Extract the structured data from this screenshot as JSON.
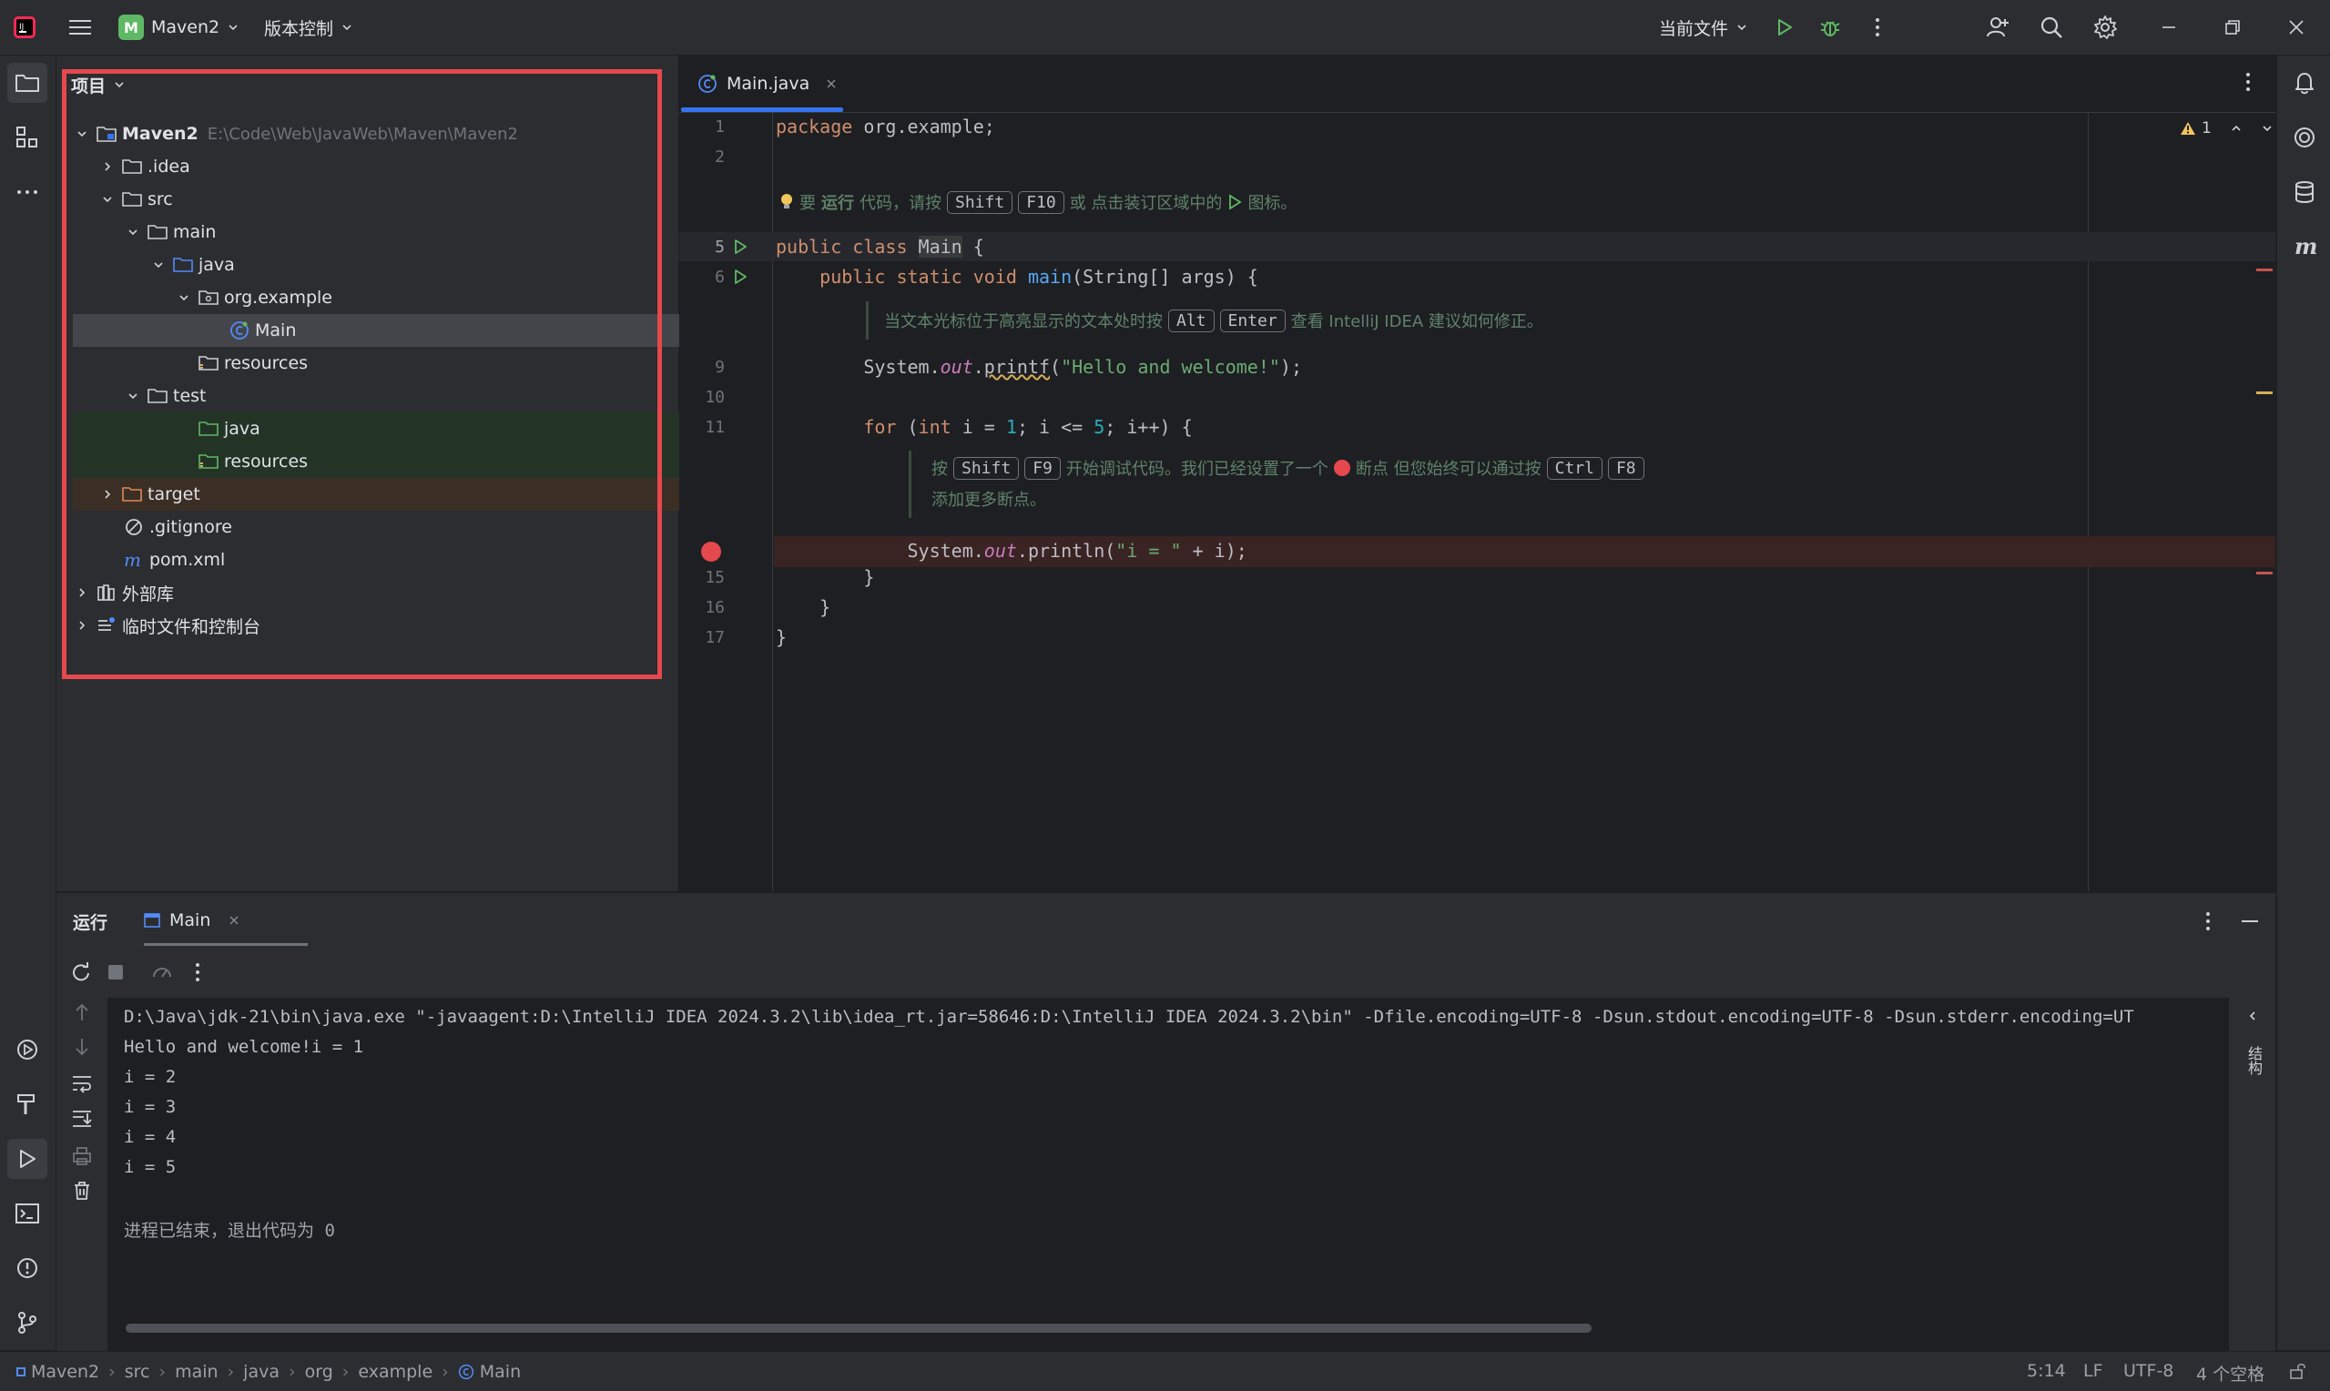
{
  "titlebar": {
    "project_initial": "M",
    "project_name": "Maven2",
    "vcs_label": "版本控制",
    "run_config": "当前文件"
  },
  "project_panel": {
    "title": "项目",
    "tree": [
      {
        "label": "Maven2",
        "path": "E:\\Code\\Web\\JavaWeb\\Maven\\Maven2"
      },
      {
        "label": ".idea"
      },
      {
        "label": "src"
      },
      {
        "label": "main"
      },
      {
        "label": "java"
      },
      {
        "label": "org.example"
      },
      {
        "label": "Main"
      },
      {
        "label": "resources"
      },
      {
        "label": "test"
      },
      {
        "label": "java"
      },
      {
        "label": "resources"
      },
      {
        "label": "target"
      },
      {
        "label": ".gitignore"
      },
      {
        "label": "pom.xml"
      },
      {
        "label": "外部库"
      },
      {
        "label": "临时文件和控制台"
      }
    ]
  },
  "editor": {
    "tab_label": "Main.java",
    "warning_count": "1",
    "line_numbers": [
      "1",
      "2",
      "5",
      "6",
      "9",
      "10",
      "11",
      "15",
      "16",
      "17"
    ],
    "code": {
      "l1_kw": "package",
      "l1_rest": " org.example;",
      "l5_kw": "public class ",
      "l5_name": "Main",
      "l5_rest": " {",
      "l6_kw": "public static void ",
      "l6_fn": "main",
      "l6_rest": "(String[] args) {",
      "l9_a": "System.",
      "l9_out": "out",
      "l9_b": ".",
      "l9_fn": "printf",
      "l9_c": "(",
      "l9_str": "\"Hello and welcome!\"",
      "l9_d": ");",
      "l11_kw": "for",
      "l11_a": " (",
      "l11_int": "int",
      "l11_b": " i = ",
      "l11_n1": "1",
      "l11_c": "; i <= ",
      "l11_n5": "5",
      "l11_d": "; i++) {",
      "l14_a": "System.",
      "l14_out": "out",
      "l14_b": ".println(",
      "l14_str": "\"i = \"",
      "l14_c": " + i);",
      "l15": "}",
      "l16": "}",
      "l17": "}"
    },
    "hints": {
      "h1_a": "要",
      "h1_b": "运行",
      "h1_c": "代码，请按",
      "h1_k1": "Shift",
      "h1_k2": "F10",
      "h1_d": "或 点击装订区域中的",
      "h1_e": "图标。",
      "h2_a": "当文本光标位于高亮显示的文本处时按",
      "h2_k1": "Alt",
      "h2_k2": "Enter",
      "h2_b": "查看 IntelliJ IDEA 建议如何修正。",
      "h3_a": "按",
      "h3_k1": "Shift",
      "h3_k2": "F9",
      "h3_b": "开始调试代码。我们已经设置了一个",
      "h3_c": "断点 但您始终可以通过按",
      "h3_k3": "Ctrl",
      "h3_k4": "F8",
      "h3_d": "添加更多断点。"
    }
  },
  "run_panel": {
    "title": "运行",
    "tab_label": "Main",
    "side_label": "结构",
    "console": [
      "D:\\Java\\jdk-21\\bin\\java.exe \"-javaagent:D:\\IntelliJ IDEA 2024.3.2\\lib\\idea_rt.jar=58646:D:\\IntelliJ IDEA 2024.3.2\\bin\" -Dfile.encoding=UTF-8 -Dsun.stdout.encoding=UTF-8 -Dsun.stderr.encoding=UT",
      "Hello and welcome!i = 1",
      "i = 2",
      "i = 3",
      "i = 4",
      "i = 5",
      "",
      "进程已结束，退出代码为 0"
    ]
  },
  "statusbar": {
    "breadcrumbs": [
      "Maven2",
      "src",
      "main",
      "java",
      "org",
      "example",
      "Main"
    ],
    "position": "5:14",
    "line_sep": "LF",
    "encoding": "UTF-8",
    "indent": "4 个空格"
  },
  "colors": {
    "accent": "#3574f0",
    "highlight_box": "#e5484d",
    "breakpoint": "#e5484d",
    "run_green": "#5fb865"
  }
}
